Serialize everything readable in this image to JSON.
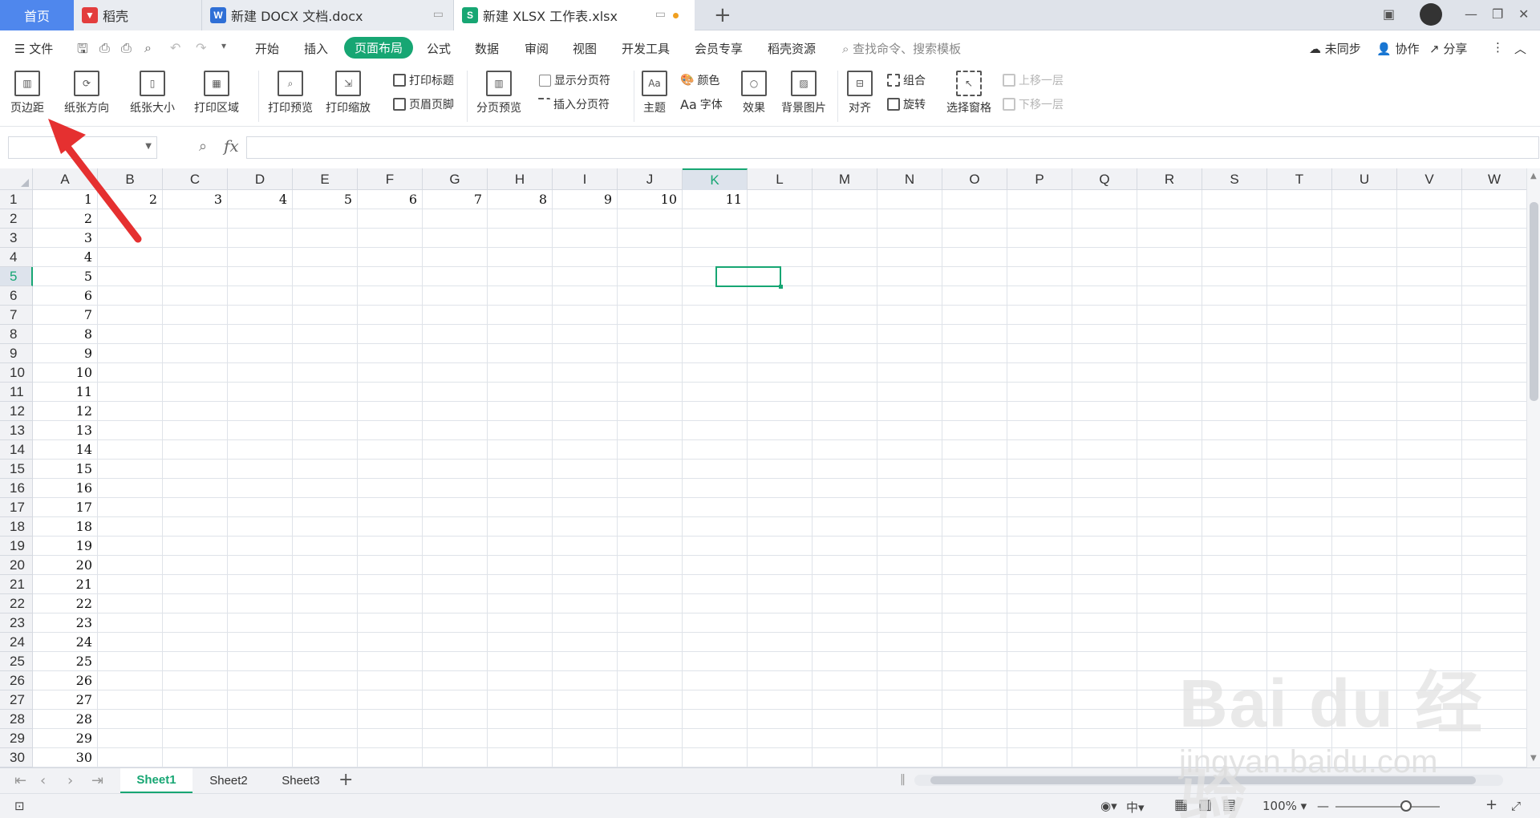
{
  "tabs": [
    {
      "label": "首页"
    },
    {
      "label": "稻壳"
    },
    {
      "label": "新建 DOCX 文档.docx"
    },
    {
      "label": "新建 XLSX 工作表.xlsx"
    }
  ],
  "menu": {
    "file": "文件",
    "items": [
      "开始",
      "插入",
      "页面布局",
      "公式",
      "数据",
      "审阅",
      "视图",
      "开发工具",
      "会员专享",
      "稻壳资源"
    ],
    "active": "页面布局",
    "search_placeholder": "查找命令、搜索模板",
    "sync": "未同步",
    "collab": "协作",
    "share": "分享"
  },
  "ribbon": {
    "margins": "页边距",
    "orientation": "纸张方向",
    "size": "纸张大小",
    "print_area": "打印区域",
    "print_preview": "打印预览",
    "print_scale": "打印缩放",
    "print_titles": "打印标题",
    "header_footer": "页眉页脚",
    "page_break_preview": "分页预览",
    "show_breaks": "显示分页符",
    "insert_break": "插入分页符",
    "theme": "主题",
    "colors": "颜色",
    "fonts": "字体",
    "effects": "效果",
    "background": "背景图片",
    "align": "对齐",
    "group": "组合",
    "rotate": "旋转",
    "selection_pane": "选择窗格",
    "bring_forward": "上移一层",
    "send_backward": "下移一层"
  },
  "formula_bar": {
    "name_box": "",
    "fx": "fx",
    "value": ""
  },
  "columns": [
    "A",
    "B",
    "C",
    "D",
    "E",
    "F",
    "G",
    "H",
    "I",
    "J",
    "K",
    "L",
    "M",
    "N",
    "O",
    "P",
    "Q",
    "R",
    "S",
    "T",
    "U",
    "V",
    "W"
  ],
  "selected_column": "K",
  "selected_row": 5,
  "row_numbers": [
    1,
    2,
    3,
    4,
    5,
    6,
    7,
    8,
    9,
    10,
    11,
    12,
    13,
    14,
    15,
    16,
    17,
    18,
    19,
    20,
    21,
    22,
    23,
    24,
    25,
    26,
    27,
    28,
    29,
    30
  ],
  "row1_values": [
    "1",
    "2",
    "3",
    "4",
    "5",
    "6",
    "7",
    "8",
    "9",
    "10",
    "11"
  ],
  "column_a_values": [
    "2",
    "3",
    "4",
    "5",
    "6",
    "7",
    "8",
    "9",
    "10",
    "11",
    "12",
    "13",
    "14",
    "15",
    "16",
    "17",
    "18",
    "19",
    "20",
    "21",
    "22",
    "23",
    "24",
    "25",
    "26",
    "27",
    "28",
    "29",
    "30"
  ],
  "sheets": [
    "Sheet1",
    "Sheet2",
    "Sheet3"
  ],
  "active_sheet": "Sheet1",
  "status": {
    "zoom": "100%"
  },
  "watermark": {
    "brand": "Bai du 经验",
    "url": "jingyan.baidu.com"
  },
  "colors": {
    "accent": "#17a673",
    "home_tab": "#4f87ed",
    "arrow": "#e53030"
  }
}
